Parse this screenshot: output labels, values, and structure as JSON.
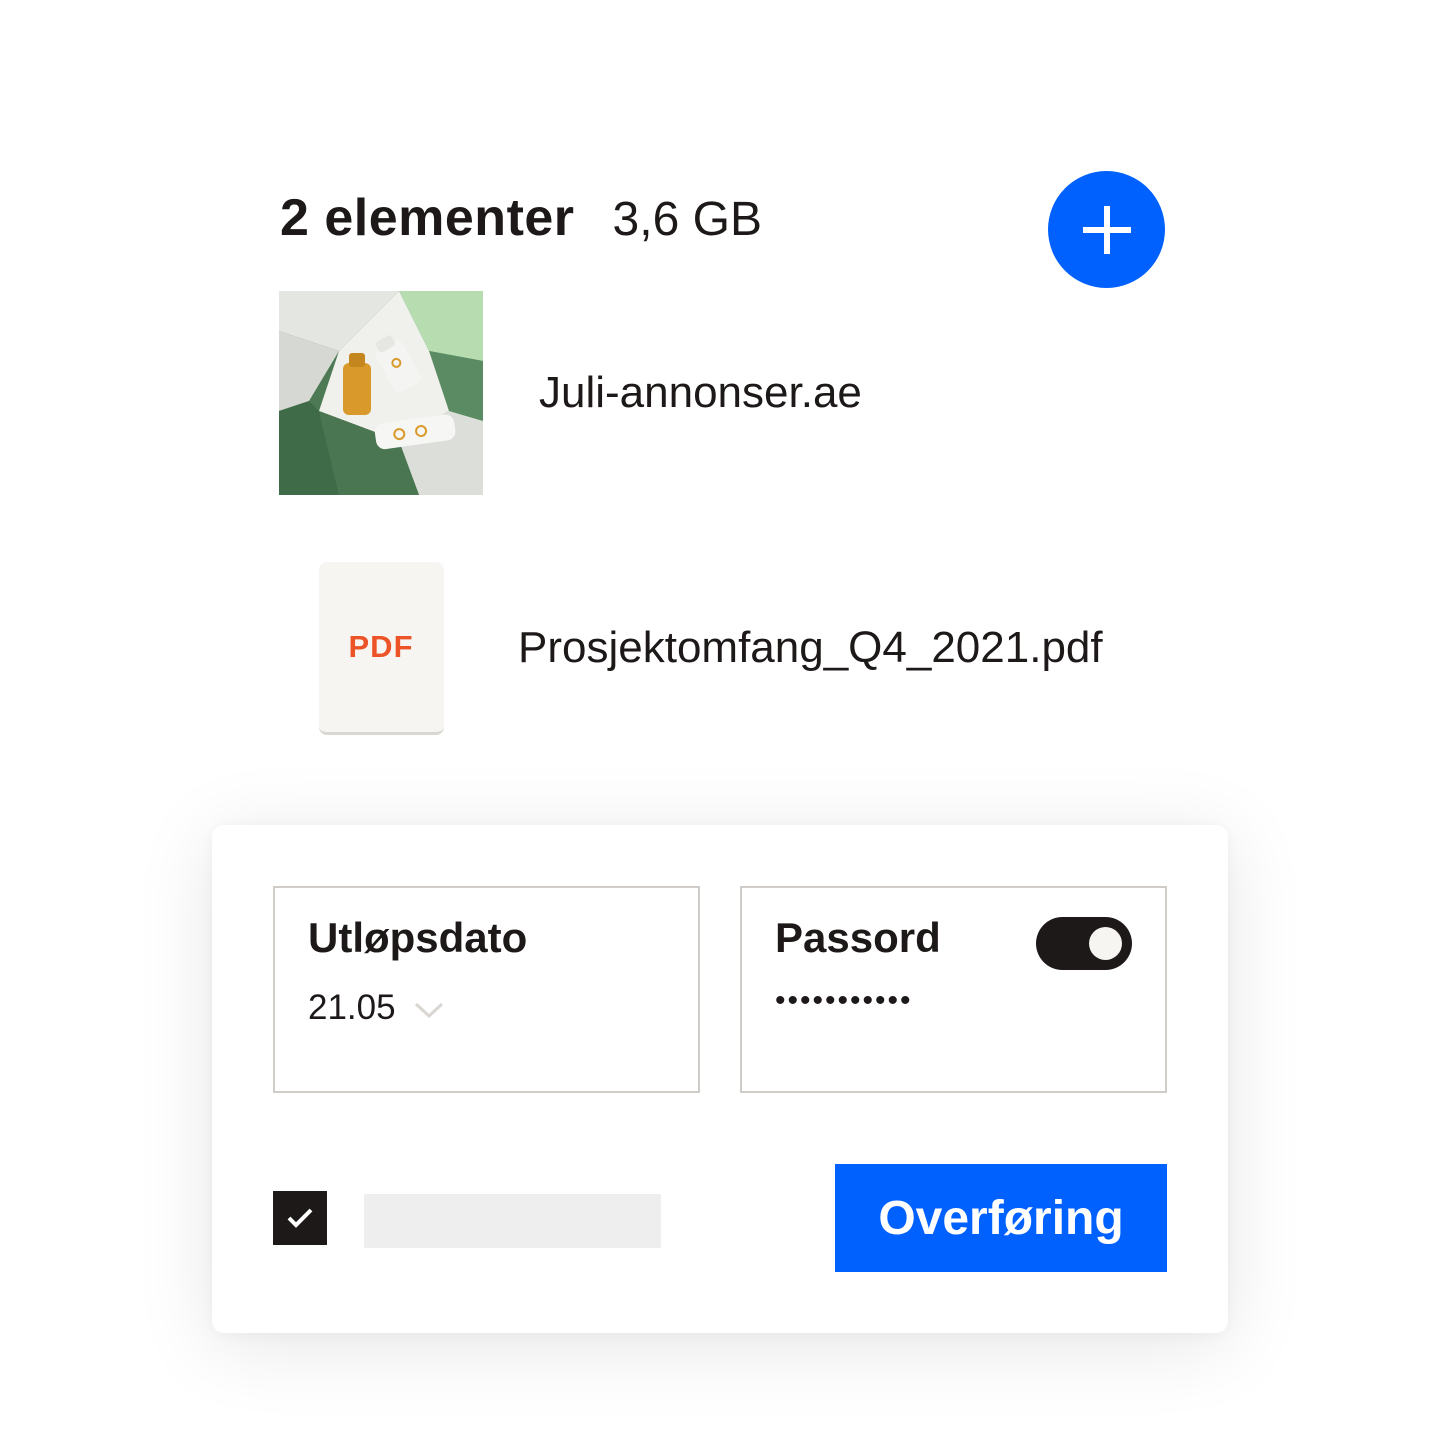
{
  "header": {
    "item_count": "2 elementer",
    "total_size": "3,6 GB",
    "add_icon": "plus-icon"
  },
  "files": [
    {
      "name": "Juli-annonser.ae",
      "thumbnail": "product-bottles-image"
    },
    {
      "name": "Prosjektomfang_Q4_2021.pdf",
      "icon_label": "PDF"
    }
  ],
  "settings": {
    "expiry": {
      "label": "Utløpsdato",
      "value": "21.05",
      "icon": "chevron-down-icon"
    },
    "password": {
      "label": "Passord",
      "value": "•••••••••••",
      "toggle_on": true
    },
    "checkbox_checked": true,
    "transfer_label": "Overføring"
  },
  "colors": {
    "accent": "#0061fe",
    "pdf": "#ec5428",
    "ink": "#1e1919"
  }
}
